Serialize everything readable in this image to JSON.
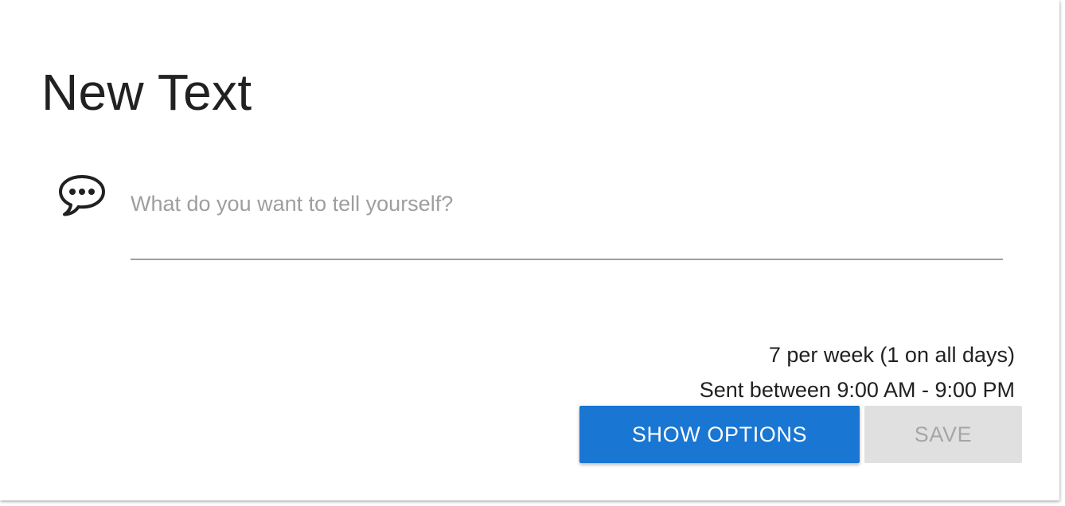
{
  "card": {
    "title": "New Text"
  },
  "message": {
    "icon": "speech-bubble-icon",
    "placeholder": "What do you want to tell yourself?",
    "value": ""
  },
  "schedule": {
    "frequency": "7 per week (1 on all days)",
    "window": "Sent between 9:00 AM - 9:00 PM"
  },
  "actions": {
    "show_options_label": "SHOW OPTIONS",
    "save_label": "SAVE",
    "save_disabled": true
  },
  "colors": {
    "primary": "#1976d2",
    "disabled_bg": "#e0e0e0",
    "disabled_text": "#a6a6a6",
    "text": "#212121",
    "placeholder": "#9e9e9e"
  }
}
